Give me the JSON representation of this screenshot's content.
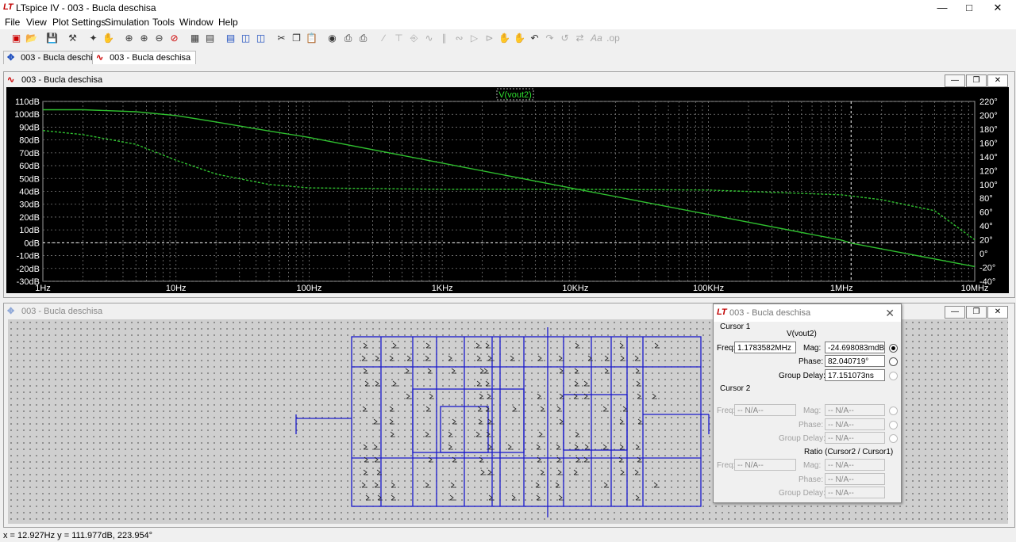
{
  "app": {
    "title": "LTspice IV - 003 - Bucla deschisa",
    "logo": "LT"
  },
  "menu": [
    "File",
    "View",
    "Plot Settings",
    "Simulation",
    "Tools",
    "Window",
    "Help"
  ],
  "tabs": [
    {
      "label": "003 - Bucla deschisa",
      "icon": "schematic-icon"
    },
    {
      "label": "003 - Bucla deschisa",
      "icon": "waveform-icon"
    }
  ],
  "plot_window": {
    "title": "003 - Bucla deschisa",
    "trace_label": "V(vout2)"
  },
  "schematic_window": {
    "title": "003 - Bucla deschisa"
  },
  "chart_data": {
    "type": "line",
    "x_scale": "log",
    "x_ticks": [
      "1Hz",
      "10Hz",
      "100Hz",
      "1KHz",
      "10KHz",
      "100KHz",
      "1MHz",
      "10MHz"
    ],
    "y_ticks_left": [
      "110dB",
      "100dB",
      "90dB",
      "80dB",
      "70dB",
      "60dB",
      "50dB",
      "40dB",
      "30dB",
      "20dB",
      "10dB",
      "0dB",
      "-10dB",
      "-20dB",
      "-30dB"
    ],
    "y_ticks_right": [
      "220°",
      "200°",
      "180°",
      "160°",
      "140°",
      "120°",
      "100°",
      "80°",
      "60°",
      "40°",
      "20°",
      "0°",
      "-20°",
      "-40°"
    ],
    "xlim": [
      1,
      10000000
    ],
    "ylim_left": [
      -30,
      110
    ],
    "ylim_right": [
      -40,
      220
    ],
    "grid": true,
    "series": [
      {
        "name": "V(vout2)",
        "kind": "magnitude",
        "color": "#2fbf2f",
        "x": [
          1,
          2,
          5,
          10,
          20,
          50,
          100,
          1000,
          10000,
          100000,
          1000000,
          1178358,
          10000000
        ],
        "y": [
          103.5,
          103.5,
          102,
          99,
          94,
          87,
          82,
          62,
          42,
          22,
          2,
          -0.3,
          -18.5
        ]
      },
      {
        "name": "V(vout2)",
        "kind": "phase",
        "color": "#2fbf2f",
        "x": [
          1,
          2,
          5,
          10,
          20,
          50,
          100,
          1000,
          10000,
          100000,
          1000000,
          2000000,
          5000000,
          10000000
        ],
        "y": [
          178,
          172,
          158,
          135,
          115,
          100,
          95,
          93,
          93,
          92,
          85,
          78,
          62,
          20
        ]
      }
    ],
    "cursor": {
      "x": 1178358
    }
  },
  "cursor_dialog": {
    "title": "003 - Bucla deschisa",
    "trace": "V(vout2)",
    "cursor1": {
      "heading": "Cursor 1",
      "freq_label": "Freq:",
      "freq": "1.1783582MHz",
      "mag_label": "Mag:",
      "mag": "-24.698083mdB",
      "phase_label": "Phase:",
      "phase": "82.040719°",
      "gd_label": "Group Delay:",
      "gd": "17.151073ns"
    },
    "cursor2": {
      "heading": "Cursor 2",
      "freq_label": "Freq:",
      "freq": "-- N/A--",
      "mag_label": "Mag:",
      "mag": "-- N/A--",
      "phase_label": "Phase:",
      "phase": "-- N/A--",
      "gd_label": "Group Delay:",
      "gd": "-- N/A--"
    },
    "ratio": {
      "heading": "Ratio (Cursor2 / Cursor1)",
      "freq_label": "Freq:",
      "freq": "-- N/A--",
      "mag_label": "Mag:",
      "mag": "-- N/A--",
      "phase_label": "Phase:",
      "phase": "-- N/A--",
      "gd_label": "Group Delay:",
      "gd": "-- N/A--"
    }
  },
  "status": "x = 12.927Hz    y = 111.977dB, 223.954°"
}
